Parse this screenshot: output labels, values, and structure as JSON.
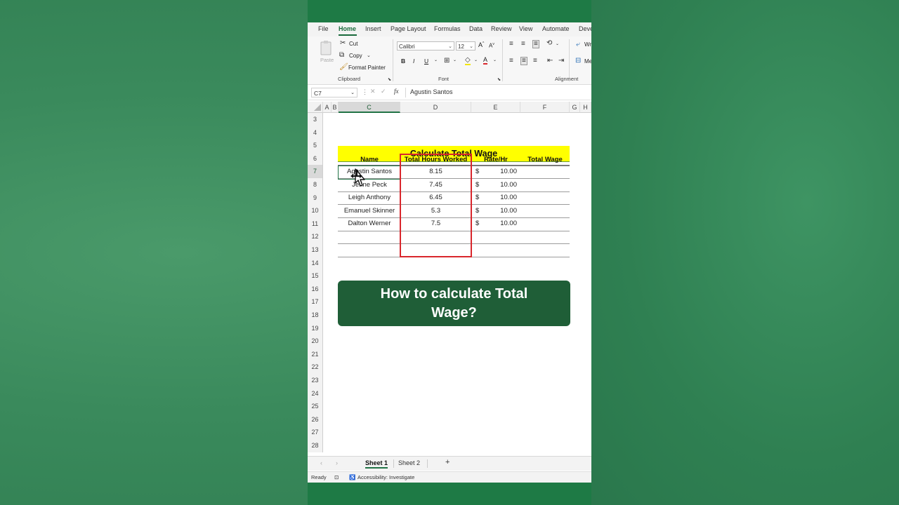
{
  "ribbon": {
    "tabs": [
      "File",
      "Home",
      "Insert",
      "Page Layout",
      "Formulas",
      "Data",
      "Review",
      "View",
      "Automate",
      "Deve"
    ],
    "active_tab": "Home",
    "clipboard": {
      "paste": "Paste",
      "cut": "Cut",
      "copy": "Copy",
      "format_painter": "Format Painter",
      "group_label": "Clipboard"
    },
    "font": {
      "name": "Calibri",
      "size": "12",
      "group_label": "Font"
    },
    "alignment": {
      "group_label": "Alignment",
      "wrap": "Wr",
      "merge": "Me"
    }
  },
  "formula_bar": {
    "name_box": "C7",
    "fx": "fx",
    "value": "Agustin Santos"
  },
  "columns": [
    "A",
    "B",
    "C",
    "D",
    "E",
    "F",
    "G",
    "H"
  ],
  "rows": [
    "3",
    "4",
    "5",
    "6",
    "7",
    "8",
    "9",
    "10",
    "11",
    "12",
    "13",
    "14",
    "15",
    "16",
    "17",
    "18",
    "19",
    "20",
    "21",
    "22",
    "23",
    "24",
    "25",
    "26",
    "27",
    "28"
  ],
  "sheet": {
    "title": "Calculate Total Wage",
    "headers": {
      "name": "Name",
      "hours": "Total Hours Worked",
      "rate": "Rate/Hr",
      "wage": "Total Wage"
    },
    "records": [
      {
        "name": "Agustin Santos",
        "hours": "8.15",
        "currency": "$",
        "rate": "10.00"
      },
      {
        "name": "Jenne Peck",
        "hours": "7.45",
        "currency": "$",
        "rate": "10.00"
      },
      {
        "name": "Leigh Anthony",
        "hours": "6.45",
        "currency": "$",
        "rate": "10.00"
      },
      {
        "name": "Emanuel Skinner",
        "hours": "5.3",
        "currency": "$",
        "rate": "10.00"
      },
      {
        "name": "Dalton Werner",
        "hours": "7.5",
        "currency": "$",
        "rate": "10.00"
      }
    ]
  },
  "banner": "How to calculate Total Wage?",
  "sheet_tabs": [
    "Sheet 1",
    "Sheet 2"
  ],
  "add_sheet": "+",
  "status": {
    "ready": "Ready",
    "accessibility": "Accessibility: Investigate"
  },
  "colors": {
    "excel_green": "#217346",
    "title_fill": "#ffff00",
    "banner_fill": "#1f5e37",
    "highlight_border": "#d9262c"
  }
}
